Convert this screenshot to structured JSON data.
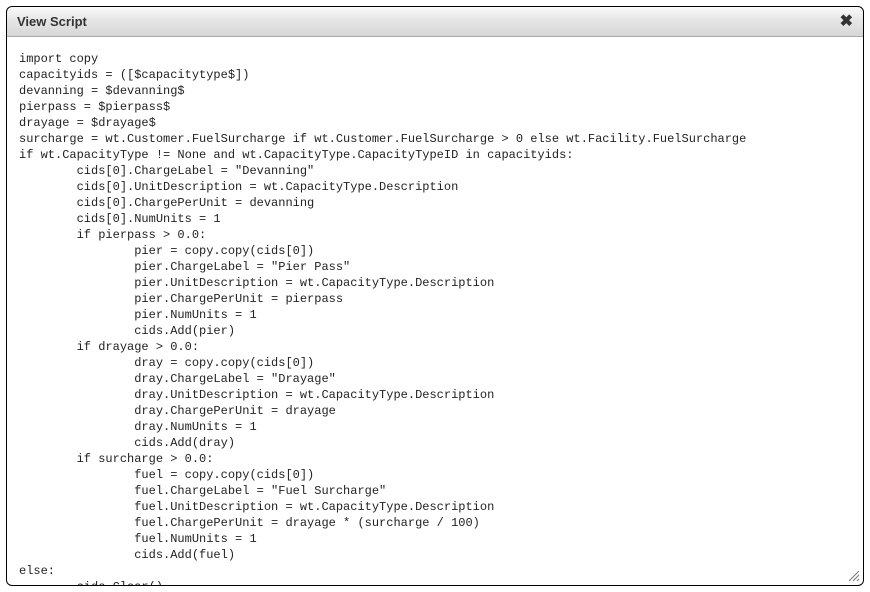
{
  "dialog": {
    "title": "View Script",
    "close_label": "✖"
  },
  "script": {
    "code": "import copy\ncapacityids = ([$capacitytype$])\ndevanning = $devanning$\npierpass = $pierpass$\ndrayage = $drayage$\nsurcharge = wt.Customer.FuelSurcharge if wt.Customer.FuelSurcharge > 0 else wt.Facility.FuelSurcharge\nif wt.CapacityType != None and wt.CapacityType.CapacityTypeID in capacityids:\n        cids[0].ChargeLabel = \"Devanning\"\n        cids[0].UnitDescription = wt.CapacityType.Description\n        cids[0].ChargePerUnit = devanning\n        cids[0].NumUnits = 1\n        if pierpass > 0.0:\n                pier = copy.copy(cids[0])\n                pier.ChargeLabel = \"Pier Pass\"\n                pier.UnitDescription = wt.CapacityType.Description\n                pier.ChargePerUnit = pierpass\n                pier.NumUnits = 1\n                cids.Add(pier)\n        if drayage > 0.0:\n                dray = copy.copy(cids[0])\n                dray.ChargeLabel = \"Drayage\"\n                dray.UnitDescription = wt.CapacityType.Description\n                dray.ChargePerUnit = drayage\n                dray.NumUnits = 1\n                cids.Add(dray)\n        if surcharge > 0.0:\n                fuel = copy.copy(cids[0])\n                fuel.ChargeLabel = \"Fuel Surcharge\"\n                fuel.UnitDescription = wt.CapacityType.Description\n                fuel.ChargePerUnit = drayage * (surcharge / 100)\n                fuel.NumUnits = 1\n                cids.Add(fuel)\nelse:\n        cids.Clear()"
  }
}
